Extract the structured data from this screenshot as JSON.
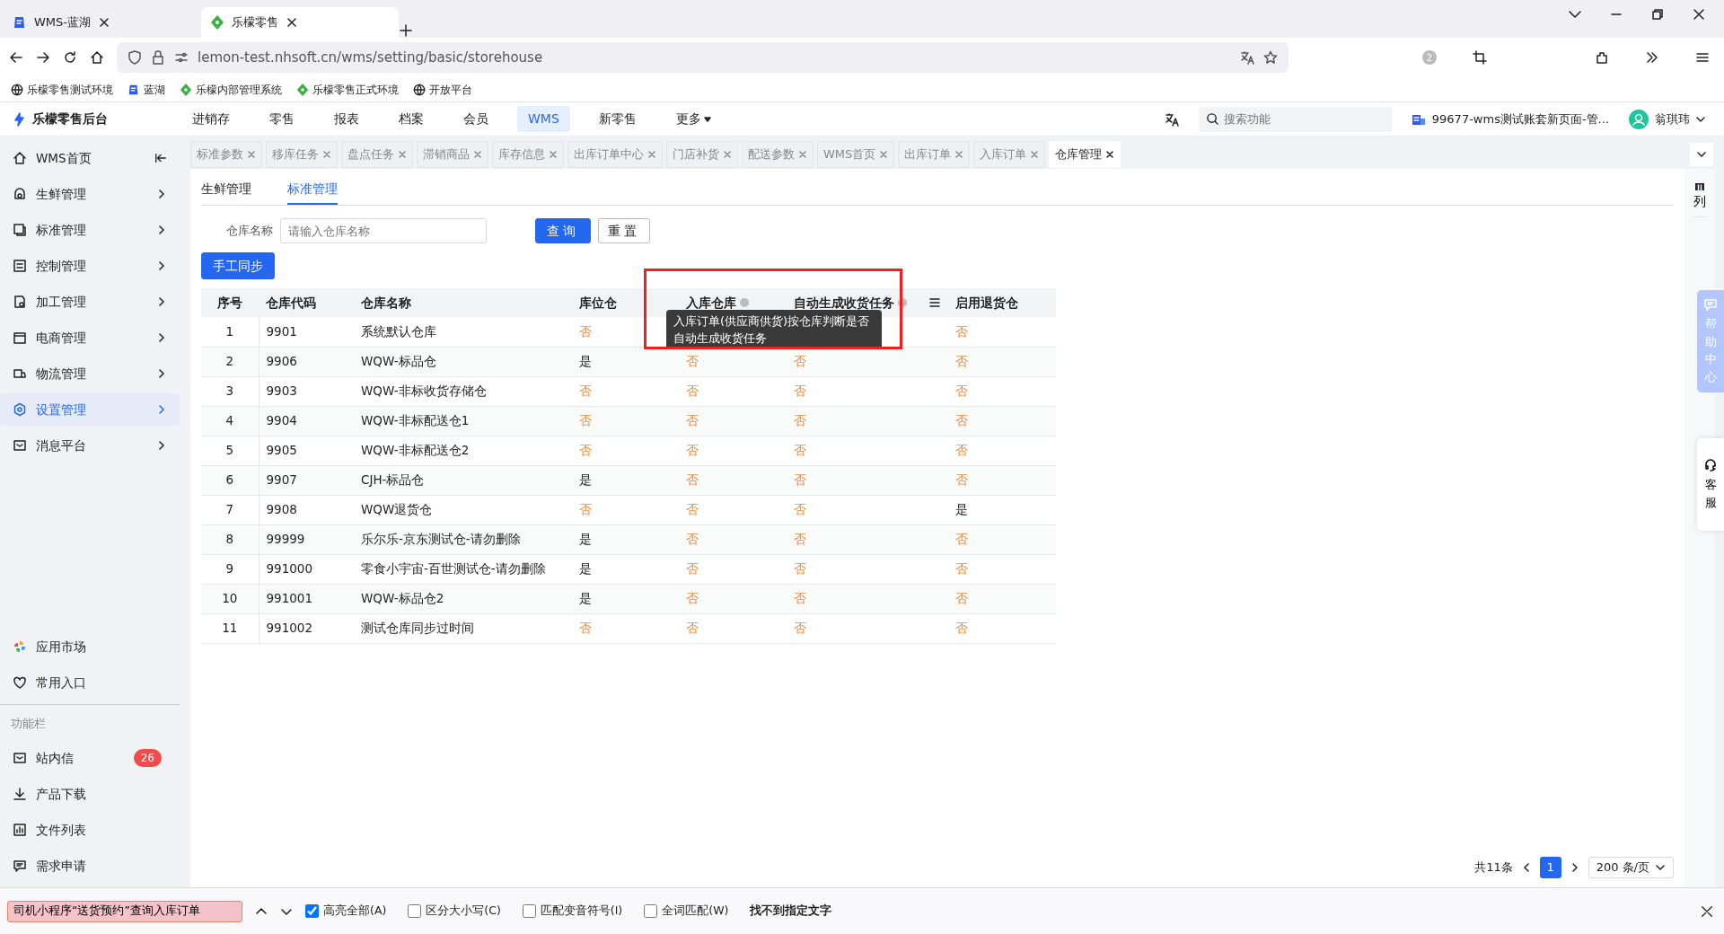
{
  "browser": {
    "tabs": [
      {
        "title": "WMS-蓝湖",
        "selected": false
      },
      {
        "title": "乐檬零售",
        "selected": true
      }
    ],
    "address": "lemon-test.nhsoft.cn/wms/setting/basic/storehouse",
    "extension_badge": "2",
    "bookmarks": [
      "乐檬零售测试环境",
      "蓝湖",
      "乐檬内部管理系统",
      "乐檬零售正式环境",
      "开放平台"
    ]
  },
  "app": {
    "logo": "乐檬零售后台",
    "nav": [
      {
        "label": "进销存",
        "selected": false
      },
      {
        "label": "零售",
        "selected": false
      },
      {
        "label": "报表",
        "selected": false
      },
      {
        "label": "档案",
        "selected": false
      },
      {
        "label": "会员",
        "selected": false
      },
      {
        "label": "WMS",
        "selected": true
      },
      {
        "label": "新零售",
        "selected": false
      },
      {
        "label": "更多",
        "selected": false
      }
    ],
    "search_placeholder": "搜索功能",
    "account": "99677-wms测试账套新页面-管...",
    "user": "翁琪玮"
  },
  "sidebar": {
    "items": [
      {
        "label": "WMS首页",
        "selected": false
      },
      {
        "label": "生鲜管理",
        "selected": false
      },
      {
        "label": "标准管理",
        "selected": false
      },
      {
        "label": "控制管理",
        "selected": false
      },
      {
        "label": "加工管理",
        "selected": false
      },
      {
        "label": "电商管理",
        "selected": false
      },
      {
        "label": "物流管理",
        "selected": false
      },
      {
        "label": "设置管理",
        "selected": true
      },
      {
        "label": "消息平台",
        "selected": false
      }
    ],
    "shortcuts": [
      "应用市场",
      "常用入口"
    ],
    "section_label": "功能栏",
    "tools": [
      {
        "label": "站内信",
        "badge": "26"
      },
      {
        "label": "产品下载"
      },
      {
        "label": "文件列表"
      },
      {
        "label": "需求申请"
      }
    ]
  },
  "page_tabs": [
    {
      "label": "标准参数",
      "selected": false
    },
    {
      "label": "移库任务",
      "selected": false
    },
    {
      "label": "盘点任务",
      "selected": false
    },
    {
      "label": "滞销商品",
      "selected": false
    },
    {
      "label": "库存信息",
      "selected": false
    },
    {
      "label": "出库订单中心",
      "selected": false
    },
    {
      "label": "门店补货",
      "selected": false
    },
    {
      "label": "配送参数",
      "selected": false
    },
    {
      "label": "WMS首页",
      "selected": false
    },
    {
      "label": "出库订单",
      "selected": false
    },
    {
      "label": "入库订单",
      "selected": false
    },
    {
      "label": "仓库管理",
      "selected": true
    }
  ],
  "sub_tabs": [
    {
      "label": "生鲜管理",
      "selected": false
    },
    {
      "label": "标准管理",
      "selected": true
    }
  ],
  "filter": {
    "label": "仓库名称",
    "placeholder": "请输入仓库名称",
    "buttons": [
      {
        "label": "查询",
        "kind": "primary"
      },
      {
        "label": "重置",
        "kind": "default"
      }
    ]
  },
  "sync_button": "手工同步",
  "table": {
    "columns": [
      {
        "label": "序号",
        "kind": "text"
      },
      {
        "label": "仓库代码",
        "kind": "text"
      },
      {
        "label": "仓库名称",
        "kind": "text"
      },
      {
        "label": "库位仓",
        "kind": "text"
      },
      {
        "label": "入库仓库",
        "kind": "info"
      },
      {
        "label": "自动生成收货任务",
        "kind": "info-menu"
      },
      {
        "label": "启用退货仓",
        "kind": "text"
      }
    ],
    "rows": [
      {
        "cells": [
          {
            "text": "1",
            "warn": false
          },
          {
            "text": "9901",
            "warn": false
          },
          {
            "text": "系统默认仓库",
            "warn": false
          },
          {
            "text": "否",
            "warn": true
          },
          null,
          null,
          {
            "text": "否",
            "warn": true
          }
        ]
      },
      {
        "cells": [
          {
            "text": "2",
            "warn": false
          },
          {
            "text": "9906",
            "warn": false
          },
          {
            "text": "WQW-标品仓",
            "warn": false
          },
          {
            "text": "是",
            "warn": false
          },
          {
            "text": "否",
            "warn": true
          },
          {
            "text": "否",
            "warn": true
          },
          {
            "text": "否",
            "warn": true
          }
        ]
      },
      {
        "cells": [
          {
            "text": "3",
            "warn": false
          },
          {
            "text": "9903",
            "warn": false
          },
          {
            "text": "WQW-非标收货存储仓",
            "warn": false
          },
          {
            "text": "否",
            "warn": true
          },
          {
            "text": "否",
            "warn": true
          },
          {
            "text": "否",
            "warn": true
          },
          {
            "text": "否",
            "warn": true
          }
        ]
      },
      {
        "cells": [
          {
            "text": "4",
            "warn": false
          },
          {
            "text": "9904",
            "warn": false
          },
          {
            "text": "WQW-非标配送仓1",
            "warn": false
          },
          {
            "text": "否",
            "warn": true
          },
          {
            "text": "否",
            "warn": true
          },
          {
            "text": "否",
            "warn": true
          },
          {
            "text": "否",
            "warn": true
          }
        ]
      },
      {
        "cells": [
          {
            "text": "5",
            "warn": false
          },
          {
            "text": "9905",
            "warn": false
          },
          {
            "text": "WQW-非标配送仓2",
            "warn": false
          },
          {
            "text": "否",
            "warn": true
          },
          {
            "text": "否",
            "warn": true
          },
          {
            "text": "否",
            "warn": true
          },
          {
            "text": "否",
            "warn": true
          }
        ]
      },
      {
        "cells": [
          {
            "text": "6",
            "warn": false
          },
          {
            "text": "9907",
            "warn": false
          },
          {
            "text": "CJH-标品仓",
            "warn": false
          },
          {
            "text": "是",
            "warn": false
          },
          {
            "text": "否",
            "warn": true
          },
          {
            "text": "否",
            "warn": true
          },
          {
            "text": "否",
            "warn": true
          }
        ]
      },
      {
        "cells": [
          {
            "text": "7",
            "warn": false
          },
          {
            "text": "9908",
            "warn": false
          },
          {
            "text": "WQW退货仓",
            "warn": false
          },
          {
            "text": "否",
            "warn": true
          },
          {
            "text": "否",
            "warn": true
          },
          {
            "text": "否",
            "warn": true
          },
          {
            "text": "是",
            "warn": false
          }
        ]
      },
      {
        "cells": [
          {
            "text": "8",
            "warn": false
          },
          {
            "text": "99999",
            "warn": false
          },
          {
            "text": "乐尔乐-京东测试仓-请勿删除",
            "warn": false
          },
          {
            "text": "是",
            "warn": false
          },
          {
            "text": "否",
            "warn": true
          },
          {
            "text": "否",
            "warn": true
          },
          {
            "text": "否",
            "warn": true
          }
        ]
      },
      {
        "cells": [
          {
            "text": "9",
            "warn": false
          },
          {
            "text": "991000",
            "warn": false
          },
          {
            "text": "零食小宇宙-百世测试仓-请勿删除",
            "warn": false
          },
          {
            "text": "是",
            "warn": false
          },
          {
            "text": "否",
            "warn": true
          },
          {
            "text": "否",
            "warn": true
          },
          {
            "text": "否",
            "warn": true
          }
        ]
      },
      {
        "cells": [
          {
            "text": "10",
            "warn": false
          },
          {
            "text": "991001",
            "warn": false
          },
          {
            "text": "WQW-标品仓2",
            "warn": false
          },
          {
            "text": "是",
            "warn": false
          },
          {
            "text": "否",
            "warn": true
          },
          {
            "text": "否",
            "warn": true
          },
          {
            "text": "否",
            "warn": true
          }
        ]
      },
      {
        "cells": [
          {
            "text": "11",
            "warn": false
          },
          {
            "text": "991002",
            "warn": false
          },
          {
            "text": "测试仓库同步过时间",
            "warn": false
          },
          {
            "text": "否",
            "warn": true
          },
          {
            "text": "否",
            "warn": true
          },
          {
            "text": "否",
            "warn": true
          },
          {
            "text": "否",
            "warn": true
          }
        ]
      }
    ],
    "tooltip": "入库订单(供应商供货)按仓库判断是否自动生成收货任务"
  },
  "column_button": "列",
  "pagination": {
    "total": "共11条",
    "pages": [
      {
        "label": "1",
        "selected": true
      }
    ],
    "page_size": "200 条/页"
  },
  "help": "帮助中心",
  "service": "客服",
  "find_bar": {
    "query": "司机小程序“送货预约”查询入库订单",
    "options": [
      {
        "label": "高亮全部(A)",
        "checked": true
      },
      {
        "label": "区分大小写(C)",
        "checked": false
      },
      {
        "label": "匹配变音符号(I)",
        "checked": false
      },
      {
        "label": "全词匹配(W)",
        "checked": false
      }
    ],
    "status": "找不到指定文字"
  }
}
